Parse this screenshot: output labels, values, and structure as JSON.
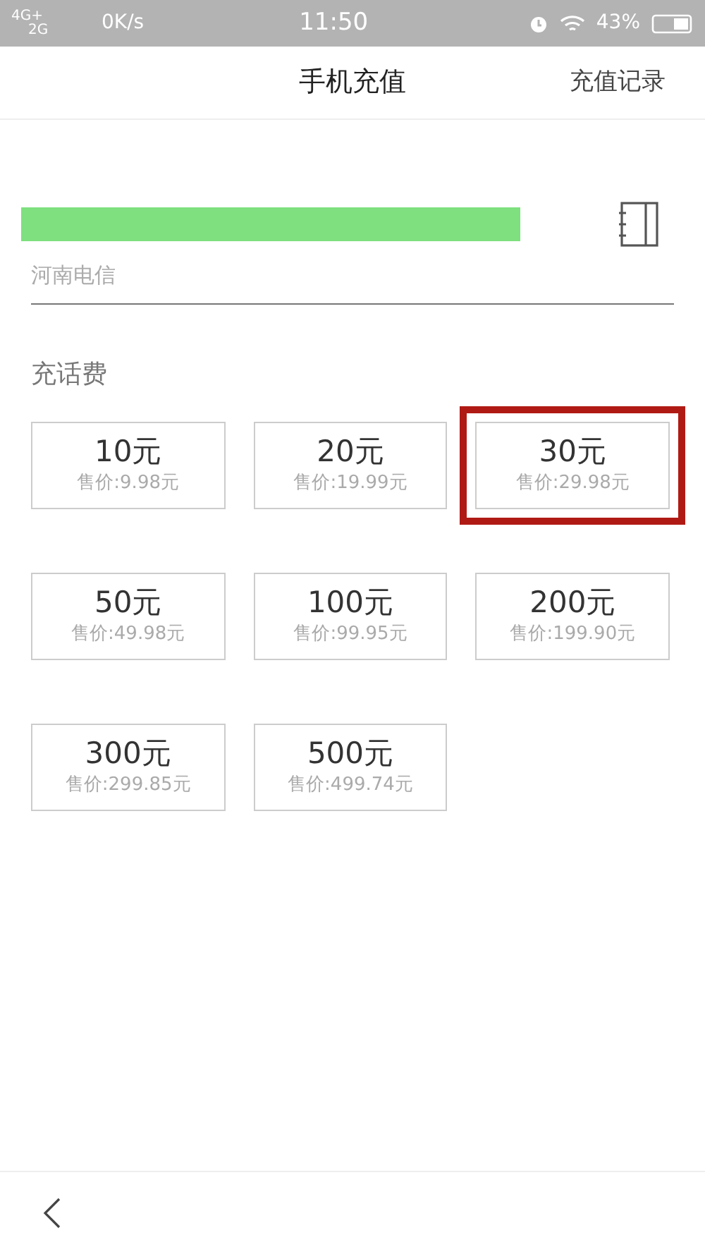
{
  "status_bar": {
    "network_1": "4G+",
    "network_2": "2G",
    "speed": "0K/s",
    "time": "11:50",
    "battery": "43%"
  },
  "header": {
    "title": "手机充值",
    "action": "充值记录"
  },
  "phone": {
    "carrier": "河南电信"
  },
  "section": {
    "title": "充话费"
  },
  "options": [
    {
      "amount": "10元",
      "price": "售价:9.98元",
      "highlighted": false
    },
    {
      "amount": "20元",
      "price": "售价:19.99元",
      "highlighted": false
    },
    {
      "amount": "30元",
      "price": "售价:29.98元",
      "highlighted": true
    },
    {
      "amount": "50元",
      "price": "售价:49.98元",
      "highlighted": false
    },
    {
      "amount": "100元",
      "price": "售价:99.95元",
      "highlighted": false
    },
    {
      "amount": "200元",
      "price": "售价:199.90元",
      "highlighted": false
    },
    {
      "amount": "300元",
      "price": "售价:299.85元",
      "highlighted": false
    },
    {
      "amount": "500元",
      "price": "售价:499.74元",
      "highlighted": false
    }
  ]
}
